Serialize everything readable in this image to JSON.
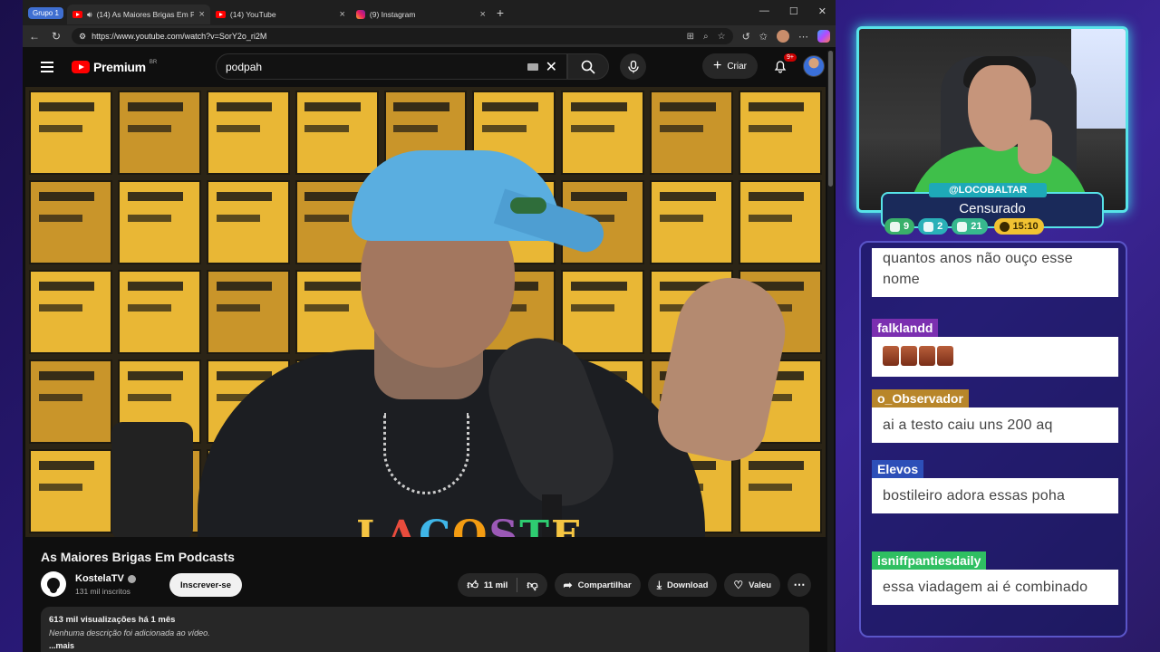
{
  "browser": {
    "group_label": "Grupo 1",
    "tabs": [
      {
        "title": "(14) As Maiores Brigas Em Po",
        "icon": "youtube-icon",
        "active": true
      },
      {
        "title": "(14) YouTube",
        "icon": "youtube-icon",
        "active": false
      },
      {
        "title": "(9) Instagram",
        "icon": "instagram-icon",
        "active": false
      }
    ],
    "url": "https://www.youtube.com/watch?v=SorY2o_ri2M"
  },
  "youtube": {
    "brand": "Premium",
    "region": "BR",
    "search_value": "podpah",
    "create_label": "Criar",
    "notifications_badge": "9+",
    "video_title": "As Maiores Brigas Em Podcasts",
    "channel": {
      "name": "KostelaTV",
      "subscribers": "131 mil inscritos",
      "subscribe_label": "Inscrever-se"
    },
    "actions": {
      "likes": "11 mil",
      "share": "Compartilhar",
      "download": "Download",
      "thanks": "Valeu"
    },
    "description": {
      "stats": "613 mil visualizações  há 1 mês",
      "text": "Nenhuma descrição foi adicionada ao vídeo.",
      "more": "...mais"
    },
    "video_caption": "LACOSTE"
  },
  "stream": {
    "handle": "@LOCOBALTAR",
    "title": "Censurado",
    "stats": {
      "twitch": "9",
      "youtube": "2",
      "kick": "21",
      "time": "15:10"
    }
  },
  "chat": {
    "messages": [
      {
        "user": "",
        "text": "quantos anos não ouço esse nome"
      },
      {
        "user": "falklandd",
        "text": ""
      },
      {
        "user": "o_Observador",
        "text": "ai a testo caiu uns 200 aq"
      },
      {
        "user": "Elevos",
        "text": "bostileiro adora essas poha"
      },
      {
        "user": "isniffpantiesdaily",
        "text": "essa viadagem ai é combinado"
      }
    ]
  },
  "colors": {
    "youtube_red": "#ff0000",
    "accent_cyan": "#57e3e8",
    "chat_white": "#ffffff"
  }
}
